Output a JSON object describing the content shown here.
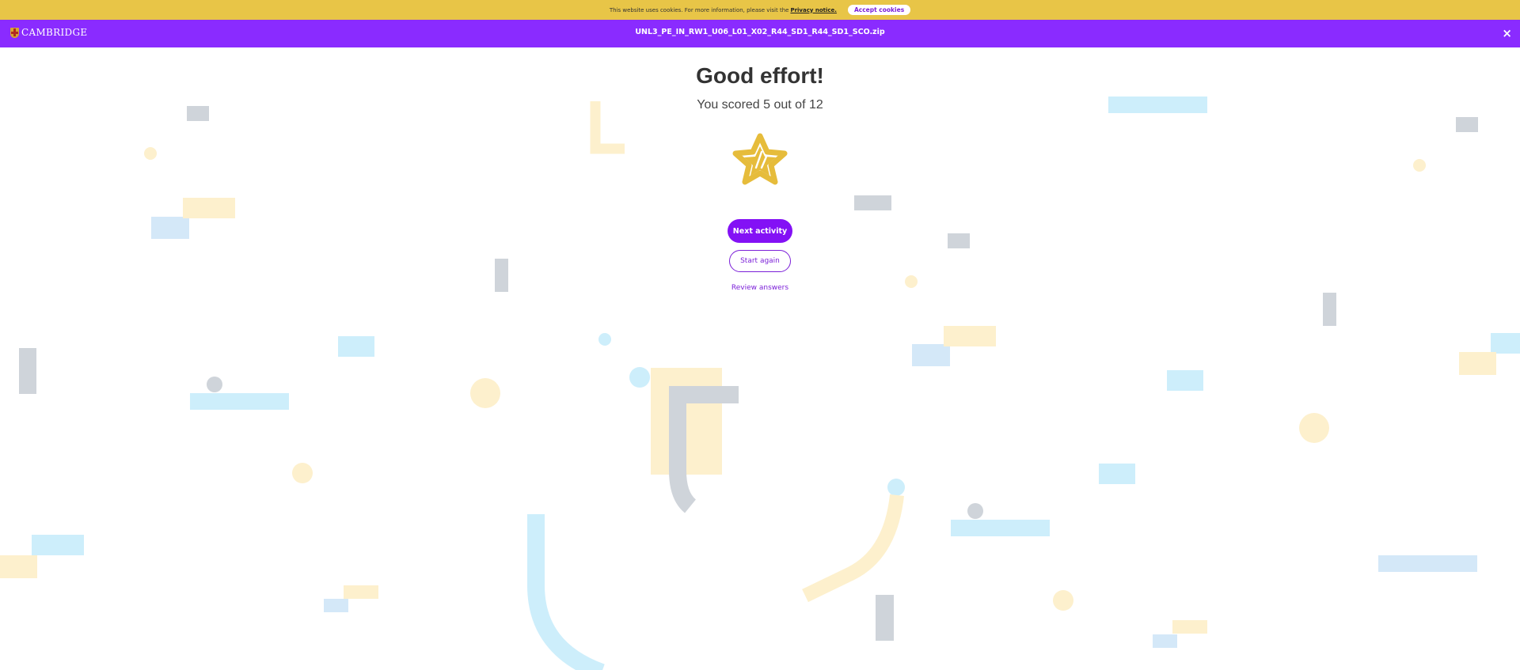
{
  "cookie_bar": {
    "message": "This website uses cookies. For more information, please visit the",
    "link_text": "Privacy notice.",
    "accept_label": "Accept cookies"
  },
  "header": {
    "logo_text": "CAMBRIDGE",
    "filename": "UNL3_PE_IN_RW1_U06_L01_X02_R44_SD1_R44_SD1_SCO.zip",
    "close_label": "×"
  },
  "result": {
    "title": "Good effort!",
    "score_text": "You scored 5 out of 12",
    "next_label": "Next activity",
    "again_label": "Start again",
    "review_label": "Review answers"
  },
  "icons": {
    "star": "star-icon",
    "logo": "cambridge-shield-icon",
    "close": "close-icon"
  },
  "colors": {
    "cookie_bar": "#e8c547",
    "header": "#8a2bff",
    "primary_button": "#8311f5",
    "star": "#e6bc3b"
  }
}
